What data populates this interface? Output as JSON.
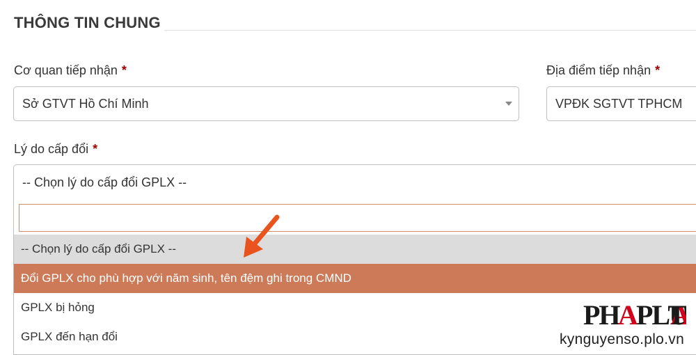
{
  "section": {
    "title": "THÔNG TIN CHUNG"
  },
  "fields": {
    "agency": {
      "label": "Cơ quan tiếp nhận",
      "required_mark": "*",
      "value": "Sở GTVT Hồ Chí Minh"
    },
    "location": {
      "label": "Địa điểm tiếp nhận",
      "required_mark": "*",
      "value": "VPĐK SGTVT TPHCM"
    },
    "reason": {
      "label": "Lý do cấp đổi",
      "required_mark": "*",
      "value": "-- Chọn lý do cấp đổi GPLX --",
      "search_value": "",
      "options": [
        {
          "label": "-- Chọn lý do cấp đổi GPLX --",
          "state": "placeholder"
        },
        {
          "label": "Đổi GPLX cho phù hợp với năm sinh, tên đệm ghi trong CMND",
          "state": "highlighted"
        },
        {
          "label": "GPLX bị hỏng",
          "state": "normal"
        },
        {
          "label": "GPLX đến hạn đổi",
          "state": "normal"
        }
      ]
    }
  },
  "watermark": {
    "logo": "PHAPLUAT",
    "site": "kynguyenso.plo.vn"
  },
  "colors": {
    "highlight": "#cd7a58",
    "placeholder_bg": "#dcdcdc",
    "required": "#a40000",
    "arrow": "#e8531e",
    "logo_red": "#d0021b"
  }
}
